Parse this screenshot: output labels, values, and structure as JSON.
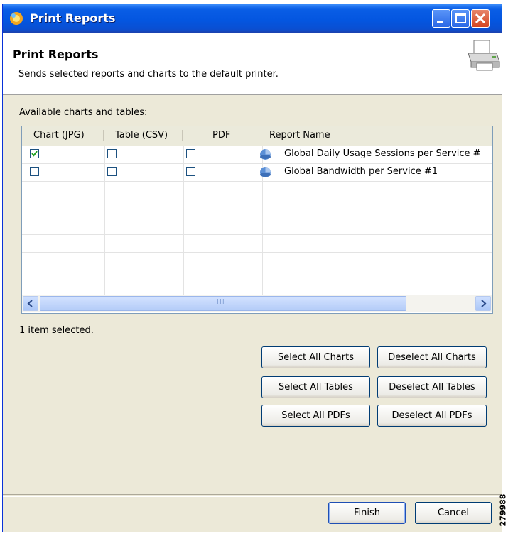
{
  "window": {
    "title": "Print Reports",
    "titlebar_color": "#0a5ee6",
    "buttons": [
      "minimize",
      "maximize",
      "close"
    ]
  },
  "header": {
    "title": "Print Reports",
    "description": "Sends selected reports and charts to the default printer.",
    "icon": "printer-icon"
  },
  "list": {
    "label": "Available charts and tables:",
    "columns": [
      "Chart (JPG)",
      "Table (CSV)",
      "PDF",
      "Report Name"
    ],
    "rows": [
      {
        "chart": true,
        "table": false,
        "pdf": false,
        "name": "Global Daily Usage Sessions per Service #",
        "icon": "report-icon"
      },
      {
        "chart": false,
        "table": false,
        "pdf": false,
        "name": "Global Bandwidth per Service #1",
        "icon": "report-icon"
      }
    ],
    "scrollbar_grip": "III"
  },
  "status": "1 item selected.",
  "selection_buttons": {
    "select_all_charts": "Select All Charts",
    "deselect_all_charts": "Deselect All Charts",
    "select_all_tables": "Select All Tables",
    "deselect_all_tables": "Deselect All Tables",
    "select_all_pdfs": "Select All PDFs",
    "deselect_all_pdfs": "Deselect All PDFs"
  },
  "footer": {
    "finish": "Finish",
    "cancel": "Cancel"
  },
  "side_label": "279988"
}
